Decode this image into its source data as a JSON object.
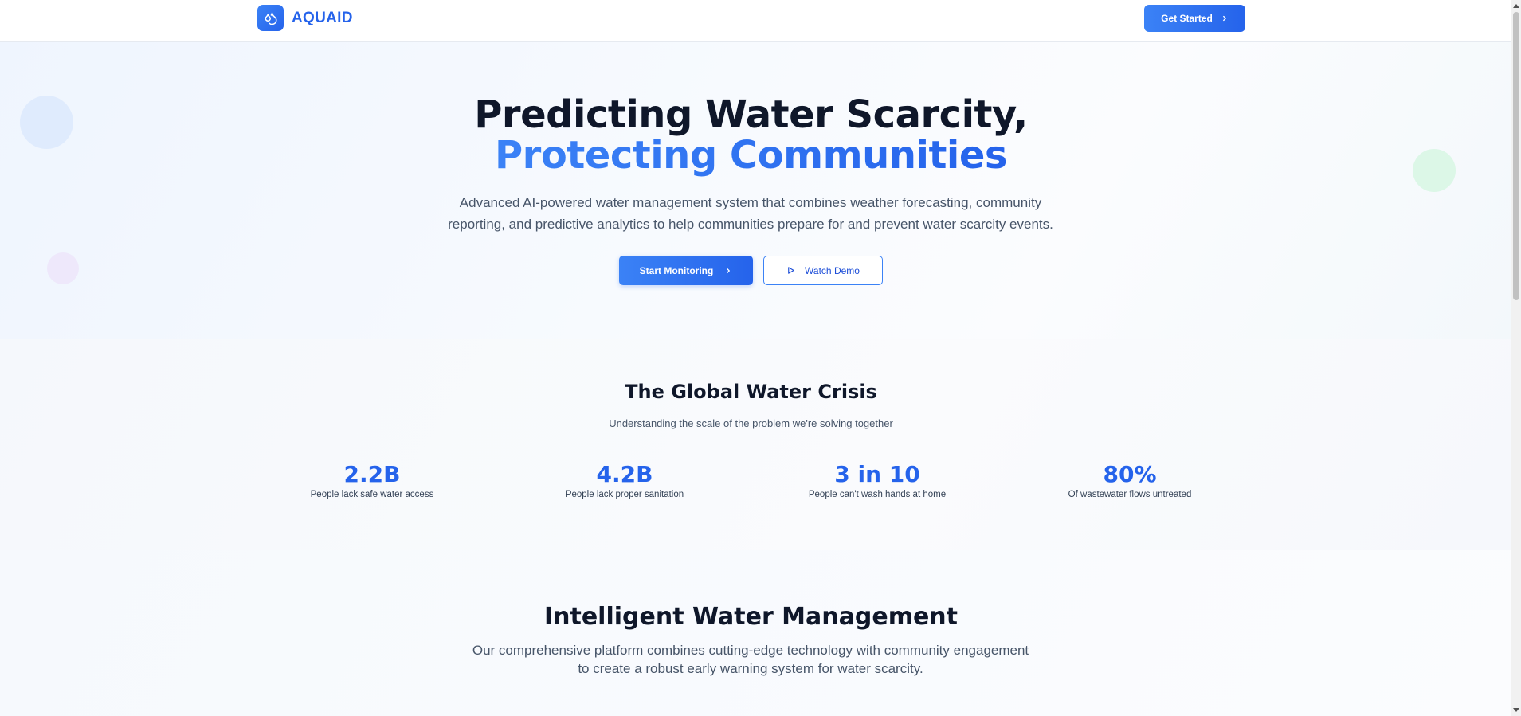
{
  "brand": {
    "name": "AQUAID",
    "icon": "droplets-icon",
    "accent": "#2563eb"
  },
  "header": {
    "cta_label": "Get Started",
    "cta_icon": "chevron-right-icon"
  },
  "hero": {
    "title_line1": "Predicting Water Scarcity,",
    "title_line2": "Protecting Communities",
    "description": "Advanced AI-powered water management system that combines weather forecasting, community reporting, and predictive analytics to help communities prepare for and prevent water scarcity events.",
    "primary_label": "Start Monitoring",
    "secondary_label": "Watch Demo"
  },
  "crisis": {
    "title": "The Global Water Crisis",
    "subtitle": "Understanding the scale of the problem we're solving together",
    "stats": [
      {
        "value": "2.2B",
        "label": "People lack safe water access"
      },
      {
        "value": "4.2B",
        "label": "People lack proper sanitation"
      },
      {
        "value": "3 in 10",
        "label": "People can't wash hands at home"
      },
      {
        "value": "80%",
        "label": "Of wastewater flows untreated"
      }
    ]
  },
  "features": {
    "title": "Intelligent Water Management",
    "description": "Our comprehensive platform combines cutting-edge technology with community engagement to create a robust early warning system for water scarcity."
  }
}
